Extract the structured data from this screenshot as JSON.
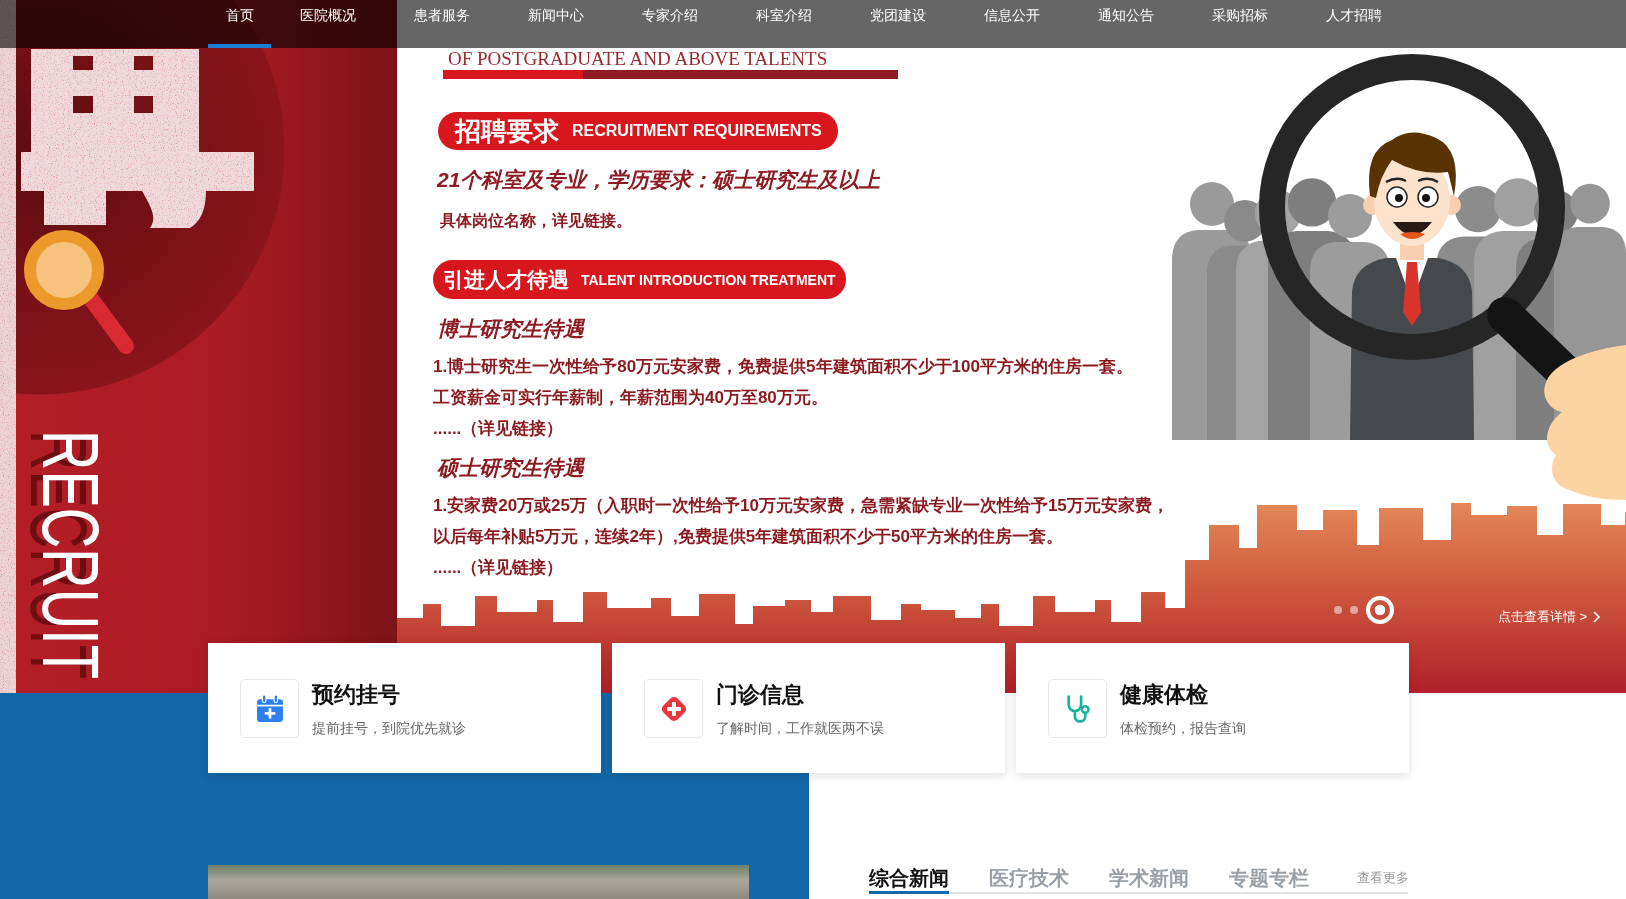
{
  "nav": {
    "items": [
      {
        "label": "首页",
        "selected": true
      },
      {
        "label": "医院概况",
        "selected": false
      },
      {
        "label": "患者服务",
        "selected": false
      },
      {
        "label": "新闻中心",
        "selected": false
      },
      {
        "label": "专家介绍",
        "selected": false
      },
      {
        "label": "科室介绍",
        "selected": false
      },
      {
        "label": "党团建设",
        "selected": false
      },
      {
        "label": "信息公开",
        "selected": false
      },
      {
        "label": "通知公告",
        "selected": false
      },
      {
        "label": "采购招标",
        "selected": false
      },
      {
        "label": "人才招聘",
        "selected": false
      }
    ]
  },
  "banner": {
    "side_label": "RECRUIT",
    "headline": "OF POSTGRADUATE AND ABOVE TALENTS",
    "sections": [
      {
        "title": "招聘要求",
        "title_en": "RECRUITMENT REQUIREMENTS",
        "content": [
          {
            "kind": "subheading",
            "text": "21个科室及专业，学历要求：硕士研究生及以上"
          },
          {
            "kind": "note",
            "text": "具体岗位名称，详见链接。"
          }
        ]
      },
      {
        "title": "引进人才待遇",
        "title_en": "TALENT INTRODUCTION TREATMENT",
        "content": [
          {
            "kind": "subheading",
            "text": "博士研究生待遇"
          },
          {
            "kind": "line",
            "text": "1.博士研究生一次性给予80万元安家费，免费提供5年建筑面积不少于100平方米的住房一套。"
          },
          {
            "kind": "line",
            "text": "工资薪金可实行年薪制，年薪范围为40万至80万元。"
          },
          {
            "kind": "line",
            "text": "......（详见链接）"
          },
          {
            "kind": "subheading",
            "text": "硕士研究生待遇"
          },
          {
            "kind": "line",
            "text": "1.安家费20万或25万（入职时一次性给予10万元安家费，急需紧缺专业一次性给予15万元安家费，"
          },
          {
            "kind": "line",
            "text": "以后每年补贴5万元，连续2年）,免费提供5年建筑面积不少于50平方米的住房一套。"
          },
          {
            "kind": "line",
            "text": "......（详见链接）"
          }
        ]
      }
    ],
    "carousel_dots": [
      {
        "selected": false
      },
      {
        "selected": false
      },
      {
        "selected": true
      }
    ],
    "details_link": "点击查看详情 >"
  },
  "services": [
    {
      "title": "预约挂号",
      "subtitle": "提前挂号，到院优先就诊"
    },
    {
      "title": "门诊信息",
      "subtitle": "了解时间，工作就医两不误"
    },
    {
      "title": "健康体检",
      "subtitle": "体检预约，报告查询"
    }
  ],
  "news": {
    "tabs": [
      {
        "label": "综合新闻",
        "selected": true
      },
      {
        "label": "医疗技术",
        "selected": false
      },
      {
        "label": "学术新闻",
        "selected": false
      },
      {
        "label": "专题专栏",
        "selected": false
      }
    ],
    "more_link": "查看更多"
  }
}
